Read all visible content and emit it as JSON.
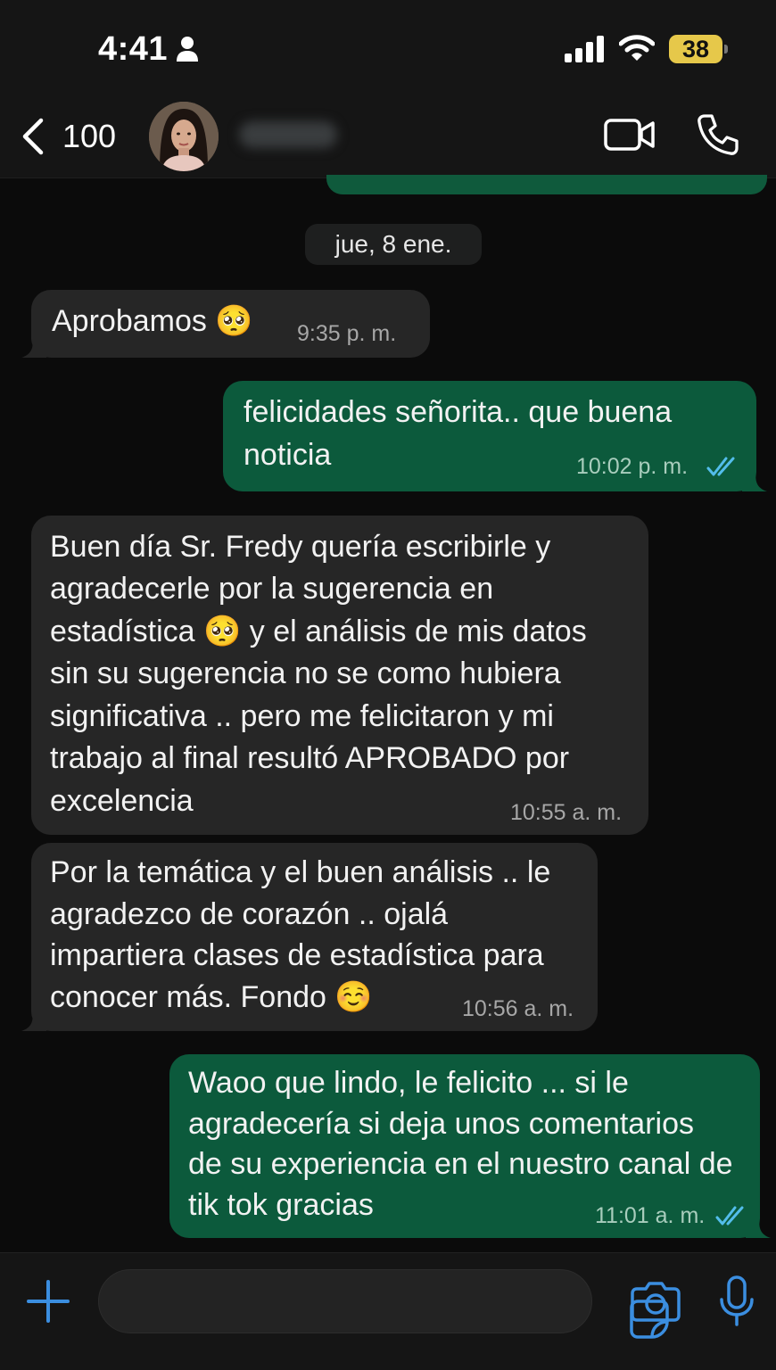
{
  "status_bar": {
    "time": "4:41",
    "battery": "38",
    "icons": [
      "person-icon",
      "signal-icon",
      "wifi-icon",
      "battery-icon"
    ]
  },
  "header": {
    "back_count": "100",
    "icons": [
      "chevron-left-icon",
      "video-call-icon",
      "phone-icon"
    ]
  },
  "date_chip": "jue, 8 ene.",
  "messages": [
    {
      "direction": "incoming",
      "lines": [
        "Aprobamos 🥺"
      ],
      "time": "9:35 p. m."
    },
    {
      "direction": "outgoing",
      "lines": [
        "felicidades señorita.. que buena",
        "noticia"
      ],
      "time": "10:02 p. m.",
      "status": "read"
    },
    {
      "direction": "incoming",
      "lines": [
        "Buen día Sr. Fredy quería escribirle y",
        "agradecerle por la sugerencia en",
        "estadística 🥺 y el análisis de mis datos",
        "sin su sugerencia no se como hubiera",
        "significativa .. pero me felicitaron y mi",
        "trabajo al final resultó APROBADO por",
        "excelencia"
      ],
      "time": "10:55 a. m."
    },
    {
      "direction": "incoming",
      "lines": [
        "Por la temática y el buen análisis .. le",
        "agradezco de corazón .. ojalá",
        "impartiera clases de estadística para",
        "conocer más. Fondo ☺️"
      ],
      "time": "10:56 a. m."
    },
    {
      "direction": "outgoing",
      "lines": [
        "Waoo que lindo, le felicito ... si le",
        "agradecería si deja unos comentarios",
        "de su experiencia en el nuestro canal de",
        "tik tok gracias"
      ],
      "time": "11:01 a. m.",
      "status": "read"
    }
  ],
  "composer": {
    "placeholder": "",
    "icons": [
      "plus-icon",
      "sticker-icon",
      "camera-icon",
      "microphone-icon"
    ]
  },
  "colors": {
    "incoming_bubble": "#262626",
    "outgoing_bubble": "#0c5a3c",
    "accent_blue": "#3b8ee0",
    "read_ticks": "#53bdeb",
    "battery": "#e6c84a"
  }
}
